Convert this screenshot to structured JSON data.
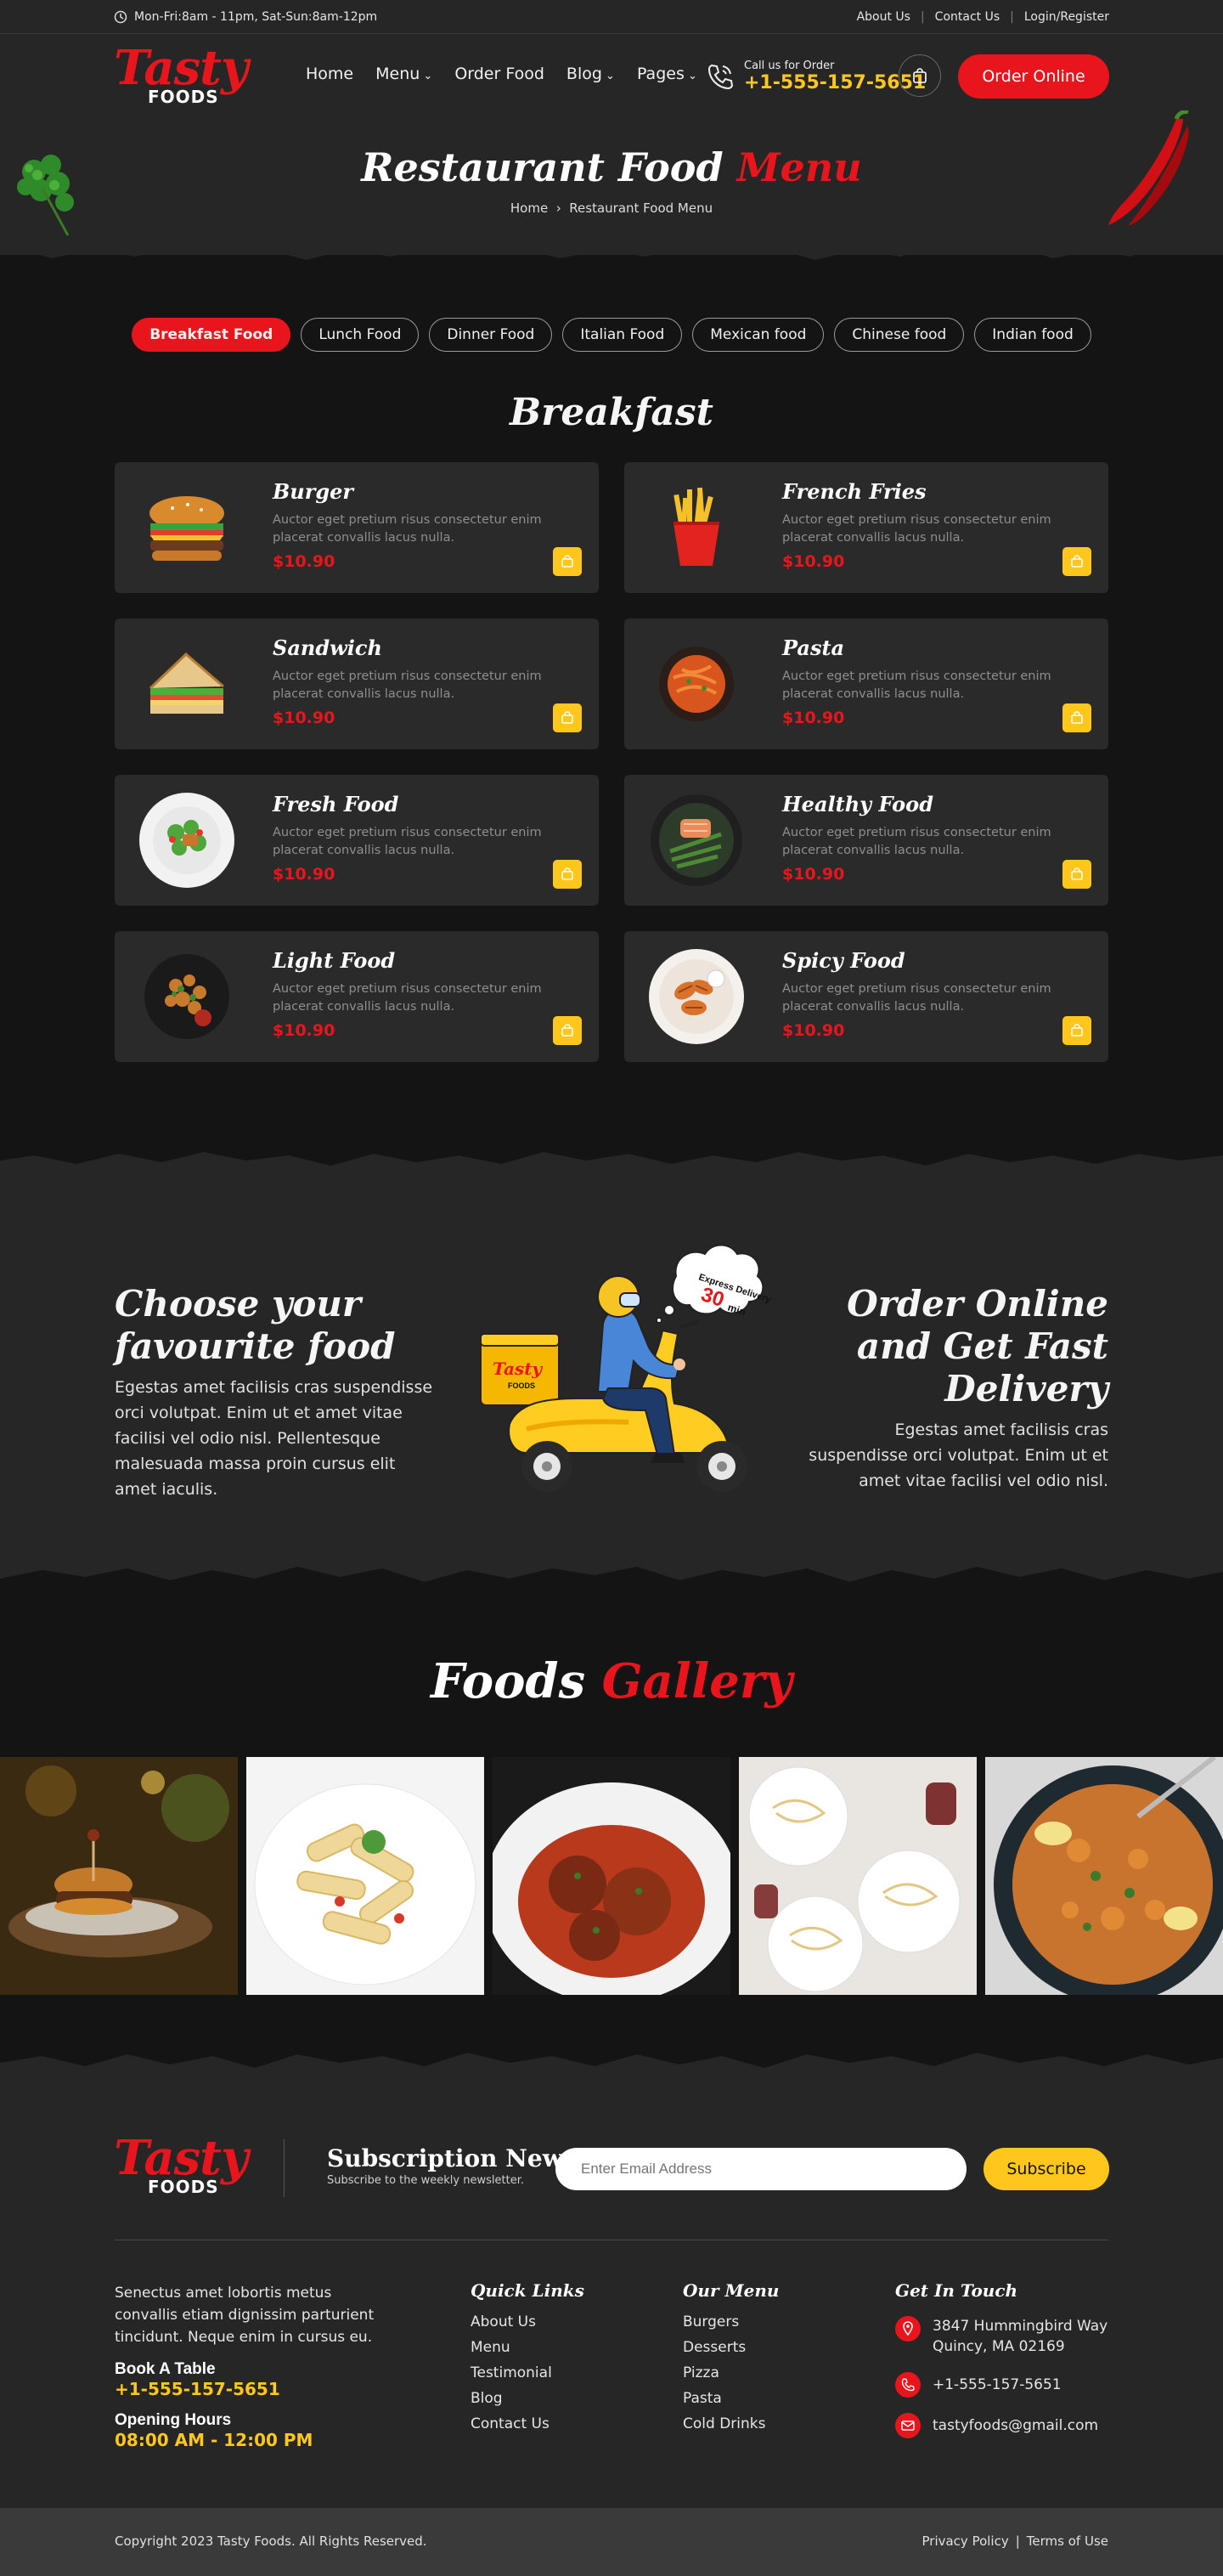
{
  "topbar": {
    "hours": "Mon-Fri:8am - 11pm, Sat-Sun:8am-12pm",
    "links": [
      "About Us",
      "Contact Us",
      "Login/Register"
    ]
  },
  "header": {
    "logo_main": "Tasty",
    "logo_sub": "FOODS",
    "nav": [
      "Home",
      "Menu",
      "Order Food",
      "Blog",
      "Pages"
    ],
    "call_label": "Call us for Order",
    "call_number": "+1-555-157-5651",
    "order_button": "Order Online"
  },
  "hero": {
    "title_white": "Restaurant Food",
    "title_red": "Menu",
    "breadcrumb_home": "Home",
    "breadcrumb_current": "Restaurant Food Menu"
  },
  "tabs": [
    "Breakfast Food",
    "Lunch Food",
    "Dinner Food",
    "Italian Food",
    "Mexican food",
    "Chinese food",
    "Indian food"
  ],
  "menu": {
    "title": "Breakfast",
    "items": [
      {
        "name": "Burger",
        "desc": "Auctor eget pretium risus consectetur enim placerat convallis lacus nulla.",
        "price": "$10.90"
      },
      {
        "name": "French Fries",
        "desc": "Auctor eget pretium risus consectetur enim placerat convallis lacus nulla.",
        "price": "$10.90"
      },
      {
        "name": "Sandwich",
        "desc": "Auctor eget pretium risus consectetur enim placerat convallis lacus nulla.",
        "price": "$10.90"
      },
      {
        "name": "Pasta",
        "desc": "Auctor eget pretium risus consectetur enim placerat convallis lacus nulla.",
        "price": "$10.90"
      },
      {
        "name": "Fresh Food",
        "desc": "Auctor eget pretium risus consectetur enim placerat convallis lacus nulla.",
        "price": "$10.90"
      },
      {
        "name": "Healthy Food",
        "desc": "Auctor eget pretium risus consectetur enim placerat convallis lacus nulla.",
        "price": "$10.90"
      },
      {
        "name": "Light Food",
        "desc": "Auctor eget pretium risus consectetur enim placerat convallis lacus nulla.",
        "price": "$10.90"
      },
      {
        "name": "Spicy Food",
        "desc": "Auctor eget pretium risus consectetur enim placerat convallis lacus nulla.",
        "price": "$10.90"
      }
    ]
  },
  "promo": {
    "left_title_1": "Choose your",
    "left_title_2": "favourite food",
    "left_text": "Egestas amet facilisis cras suspendisse orci volutpat. Enim ut et amet vitae facilisi vel odio nisl. Pellentesque malesuada massa proin cursus elit amet iaculis.",
    "right_title_1": "Order Online",
    "right_title_2": "and Get Fast",
    "right_title_3": "Delivery",
    "right_text": "Egestas amet facilisis cras suspendisse orci volutpat. Enim ut et amet vitae facilisi vel odio nisl.",
    "bubble_line1": "Express Delivery",
    "bubble_num": "30",
    "bubble_unit": "min",
    "box_logo": "Tasty",
    "box_sub": "FOODS"
  },
  "gallery": {
    "title_white": "Foods",
    "title_red": "Gallery"
  },
  "footer": {
    "logo_main": "Tasty",
    "logo_sub": "FOODS",
    "sub_title": "Subscription News",
    "sub_text": "Subscribe to the weekly newsletter.",
    "sub_placeholder": "Enter Email Address",
    "sub_button": "Subscribe",
    "about": "Senectus amet lobortis metus convallis etiam dignissim parturient tincidunt. Neque enim in cursus eu.",
    "book_label": "Book A Table",
    "book_number": "+1-555-157-5651",
    "hours_label": "Opening Hours",
    "hours_value": "08:00 AM - 12:00 PM",
    "quick_title": "Quick Links",
    "quick_links": [
      "About Us",
      "Menu",
      "Testimonial",
      "Blog",
      "Contact Us"
    ],
    "menu_title": "Our Menu",
    "menu_links": [
      "Burgers",
      "Desserts",
      "Pizza",
      "Pasta",
      "Cold Drinks"
    ],
    "touch_title": "Get In Touch",
    "address_1": "3847 Hummingbird Way",
    "address_2": "Quincy, MA 02169",
    "phone": "+1-555-157-5651",
    "email": "tastyfoods@gmail.com",
    "copyright": "Copyright 2023 Tasty Foods. All Rights Reserved.",
    "privacy": "Privacy Policy",
    "terms": "Terms of Use"
  },
  "colors": {
    "accent_red": "#e8161c",
    "accent_yellow": "#ffc71c",
    "background": "#141414",
    "card": "#2a2a2a"
  }
}
